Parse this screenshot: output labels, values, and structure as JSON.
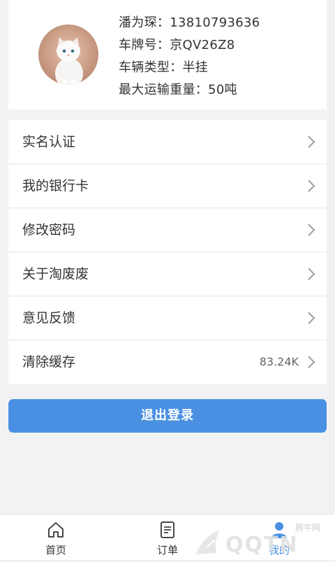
{
  "profile": {
    "name_phone": "潘为琛：13810793636",
    "plate": "车牌号：京QV26Z8",
    "vehicle_type": "车辆类型：半挂",
    "max_weight": "最大运输重量：50吨"
  },
  "menu": {
    "items": [
      {
        "label": "实名认证",
        "value": ""
      },
      {
        "label": "我的银行卡",
        "value": ""
      },
      {
        "label": "修改密码",
        "value": ""
      },
      {
        "label": "关于淘废废",
        "value": ""
      },
      {
        "label": "意见反馈",
        "value": ""
      },
      {
        "label": "清除缓存",
        "value": "83.24K"
      }
    ]
  },
  "logout_label": "退出登录",
  "tabbar": {
    "home_label": "首页",
    "order_label": "订单",
    "profile_label": "我的"
  },
  "watermark": {
    "text": "QQTN",
    "sub_text": "腾牛网"
  },
  "colors": {
    "accent": "#4a90e2",
    "background": "#f2f2f4"
  }
}
